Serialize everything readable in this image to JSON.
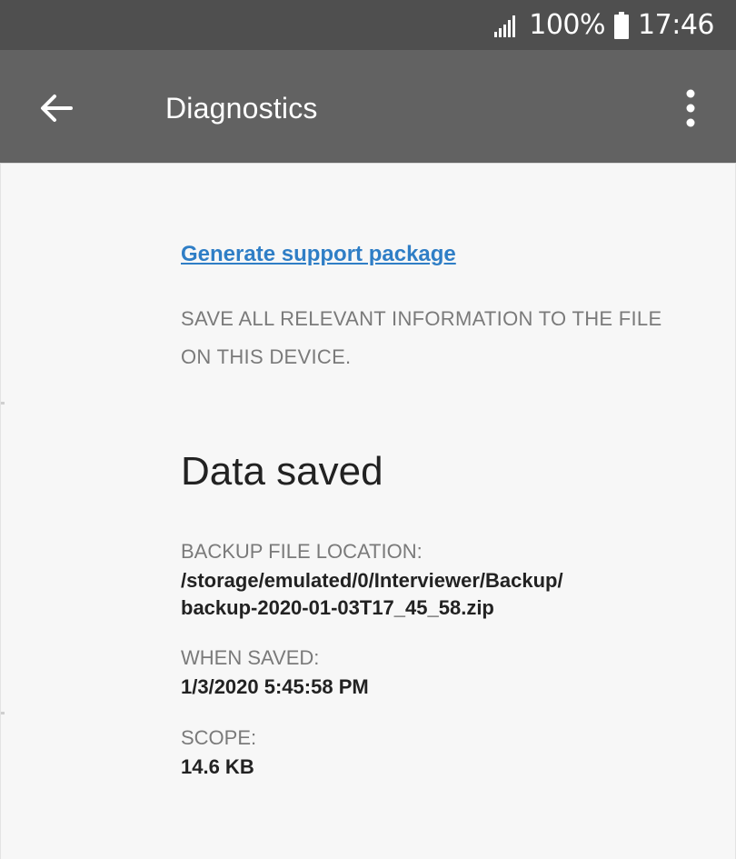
{
  "status_bar": {
    "battery_percent": "100%",
    "time": "17:46",
    "icons": [
      "signal-icon",
      "battery-icon"
    ]
  },
  "app_bar": {
    "title": "Diagnostics",
    "back_icon": "arrow-left-icon",
    "more_icon": "more-vert-icon"
  },
  "support": {
    "link_label": "Generate support package",
    "description": "SAVE ALL RELEVANT INFORMATION TO THE FILE ON THIS DEVICE."
  },
  "result": {
    "title": "Data saved",
    "location_label": "BACKUP FILE LOCATION:",
    "location_line1": "/storage/emulated/0/Interviewer/Backup/",
    "location_line2": "backup-2020-01-03T17_45_58.zip",
    "when_label": "WHEN SAVED:",
    "when_value": "1/3/2020 5:45:58 PM",
    "scope_label": "SCOPE:",
    "scope_value": "14.6 KB"
  },
  "colors": {
    "status_bar_bg": "#4f4f4f",
    "app_bar_bg": "#626262",
    "link": "#2f7ec6"
  }
}
